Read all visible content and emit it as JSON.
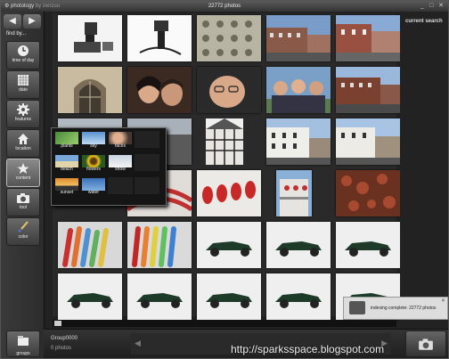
{
  "titlebar": {
    "app_name": "photology",
    "app_sub": "by zenzuu",
    "center_title": "22772 photos"
  },
  "sidebar": {
    "find_by_label": "find by...",
    "items": [
      {
        "label": "time of day",
        "icon": "clock-icon"
      },
      {
        "label": "date",
        "icon": "calendar-icon"
      },
      {
        "label": "features",
        "icon": "gear-icon"
      },
      {
        "label": "location",
        "icon": "house-icon"
      },
      {
        "label": "content",
        "icon": "star-icon"
      },
      {
        "label": "tool",
        "icon": "camera-icon"
      },
      {
        "label": "color",
        "icon": "paint-brush-icon"
      }
    ],
    "groups_label": "groups"
  },
  "right_panel": {
    "label": "current search"
  },
  "content_popup": {
    "items": [
      "plants",
      "sky",
      "faces",
      "beach",
      "flowers",
      "snow",
      "sunset",
      "water"
    ]
  },
  "bottom": {
    "group_name": "Group0000",
    "group_count": "0 photos"
  },
  "toast": {
    "text": "indexing complete: 22772 photos"
  },
  "watermark": "http://sparksspace.blogspot.com",
  "colors": {
    "background": "#222222",
    "sidebar": "#333333",
    "accent": "#aaccee"
  }
}
